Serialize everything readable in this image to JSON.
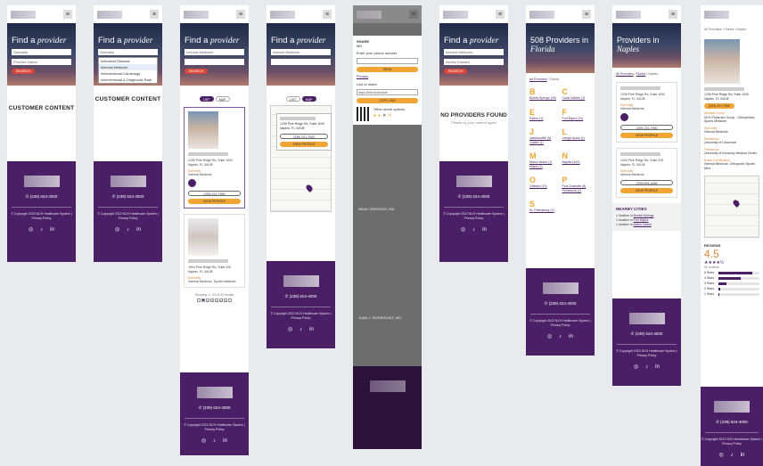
{
  "frames": {
    "f1": {
      "title_plain": "Find a ",
      "title_italic": "provider",
      "field1": "Specialty",
      "field2": "Provider Name",
      "search_label": "SEARCH",
      "content": "CUSTOMER CONTENT"
    },
    "f2": {
      "title_plain": "Find a ",
      "title_italic": "provider",
      "field1": "Specialty",
      "dropdown": [
        "Infectious Disease",
        "Internal Medicine",
        "Interventional Cardiology",
        "Interventional & Diagnostic Radi"
      ],
      "content": "CUSTOMER CONTENT"
    },
    "f3": {
      "title_plain": "Find a ",
      "title_italic": "provider",
      "field1": "Internal Medicine",
      "search_label": "SEARCH",
      "tab_list": "LIST",
      "tab_map": "MAP",
      "address": "1235 Pine Ridge Rd, Suite 1000\nNaples, FL 34108",
      "specialty_label": "Specialty",
      "specialty_value": "Internal Medicine",
      "phone_btn": "(239) 221-7900",
      "view_btn": "VIEW PROFILE",
      "address2": "1894 Pine Ridge Rd, Suite 220\nNaples, FL 34108",
      "specialty_value2": "Internal Medicine, Sports medicine",
      "showing": "Showing 1 - 20 of 30 results",
      "pages": [
        "‹",
        "1",
        "2",
        "3",
        "4",
        "5",
        "6",
        "›"
      ]
    },
    "f4": {
      "title_plain": "Find a ",
      "title_italic": "provider",
      "field1": "Internal Medicine",
      "tab_list": "LIST",
      "tab_map": "MAP",
      "address": "1235 Pine Ridge Rd, Suite 1000\nNaples, FL 34108",
      "phone_btn": "(239) 221-7900",
      "view_btn": "VIEW PROFILE"
    },
    "f5": {
      "share": "SHARE",
      "share_sub": "MD",
      "phone_label": "Enter your phone number",
      "send": "SEND",
      "terms": "Privacy",
      "link_label": "Link to share",
      "link_value": "https://link.sc/d/share",
      "copy": "COPY LINK",
      "other": "Other share options",
      "name": "BRAD GREGORY, MD",
      "name2": "JUAN J. RODRIGUEZ, MD"
    },
    "f6": {
      "title_plain": "Find a ",
      "title_italic": "provider",
      "field1": "Internal Medicine",
      "field2": "Ashley Edward",
      "search_label": "SEARCH",
      "empty_title": "NO PROVIDERS FOUND",
      "empty_sub": "Please try your search again"
    },
    "f7": {
      "heading_plain": "508 Providers in ",
      "heading_italic": "Florida",
      "crumb_home": "All Providers",
      "crumb_sep": " / ",
      "crumb_cur": "Florida",
      "cities": [
        {
          "letter": "B",
          "items": [
            "Bonita Springs (25)"
          ]
        },
        {
          "letter": "C",
          "items": [
            "Coral Gables (1)"
          ]
        },
        {
          "letter": "E",
          "items": [
            "Estero (1)"
          ]
        },
        {
          "letter": "F",
          "items": [
            "Fort Myers (11)"
          ]
        },
        {
          "letter": "J",
          "items": [
            "Jacksonville (9)",
            "Jupiter (1)"
          ]
        },
        {
          "letter": "L",
          "items": [
            "Lehigh Acres (1)"
          ]
        },
        {
          "letter": "M",
          "items": [
            "Marco Island (1)",
            "Miami (2)"
          ]
        },
        {
          "letter": "N",
          "items": [
            "Naples (443)"
          ]
        },
        {
          "letter": "O",
          "items": [
            "Orlando (10)"
          ]
        },
        {
          "letter": "P",
          "items": [
            "Port Charlotte (5)",
            "Pensacola (1)"
          ]
        },
        {
          "letter": "S",
          "items": [
            "St. Petersburg (1)"
          ]
        }
      ]
    },
    "f8": {
      "heading_plain": "Providers in ",
      "heading_italic": "Naples",
      "crumb_home": "All Providers",
      "crumb_mid": "Florida",
      "crumb_cur": "Naples",
      "address": "1235 Pine Ridge Rd, Suite 1000\nNaples, FL 34108",
      "specialty_label": "Specialty",
      "specialty_value": "Internal Medicine",
      "phone_btn": "(239) 221-7900",
      "view_btn": "VIEW PROFILE",
      "address2": "1044 Pine Ridge Rd, Suite 225\nNaples, FL 34108",
      "phone_btn2": "(239) 591-4499",
      "nearby_title": "NEARBY CITIES",
      "nearby": [
        {
          "prefix": "1 location in ",
          "city": "Bonita Springs"
        },
        {
          "prefix": "1 location in ",
          "city": "Fort Myers"
        },
        {
          "prefix": "1 location in ",
          "city": "Marco Island"
        }
      ]
    },
    "f9": {
      "crumb": "All Providers / Florida / Naples",
      "address": "1235 Pine Ridge Rd, Suite 1000\nNaples, FL 34108",
      "phone_btn": "(239) 221-7900",
      "medical_group_label": "Medical Group",
      "medical_group": "NCH Physician Group - Orthopedics, Sports Medicine",
      "specialty_label": "Specialty",
      "specialty": "Internal Medicine",
      "residency_label": "Residency",
      "residency": "University of Cincinnati",
      "fellowship_label": "Fellowship",
      "fellowship": "University of Kentucky Medical Center",
      "board_label": "Board Certification",
      "board": "Internal Medicine, Orthopedic Sports Med",
      "reviews_title": "REVIEWS",
      "rating": "4.5",
      "stars": "★★★★½",
      "review_count": "50 reviews",
      "rows": [
        "5 Stars",
        "4 Stars",
        "3 Stars",
        "2 Stars",
        "1 Stars"
      ],
      "fills": [
        0.82,
        0.55,
        0.2,
        0.05,
        0.02
      ],
      "footer_phone": "(239) 624-4000"
    }
  },
  "footer": {
    "phone": "(239) 624-4000",
    "copyright": "© Copyright 2022 NCH Healthcare System  |  Privacy Policy"
  }
}
